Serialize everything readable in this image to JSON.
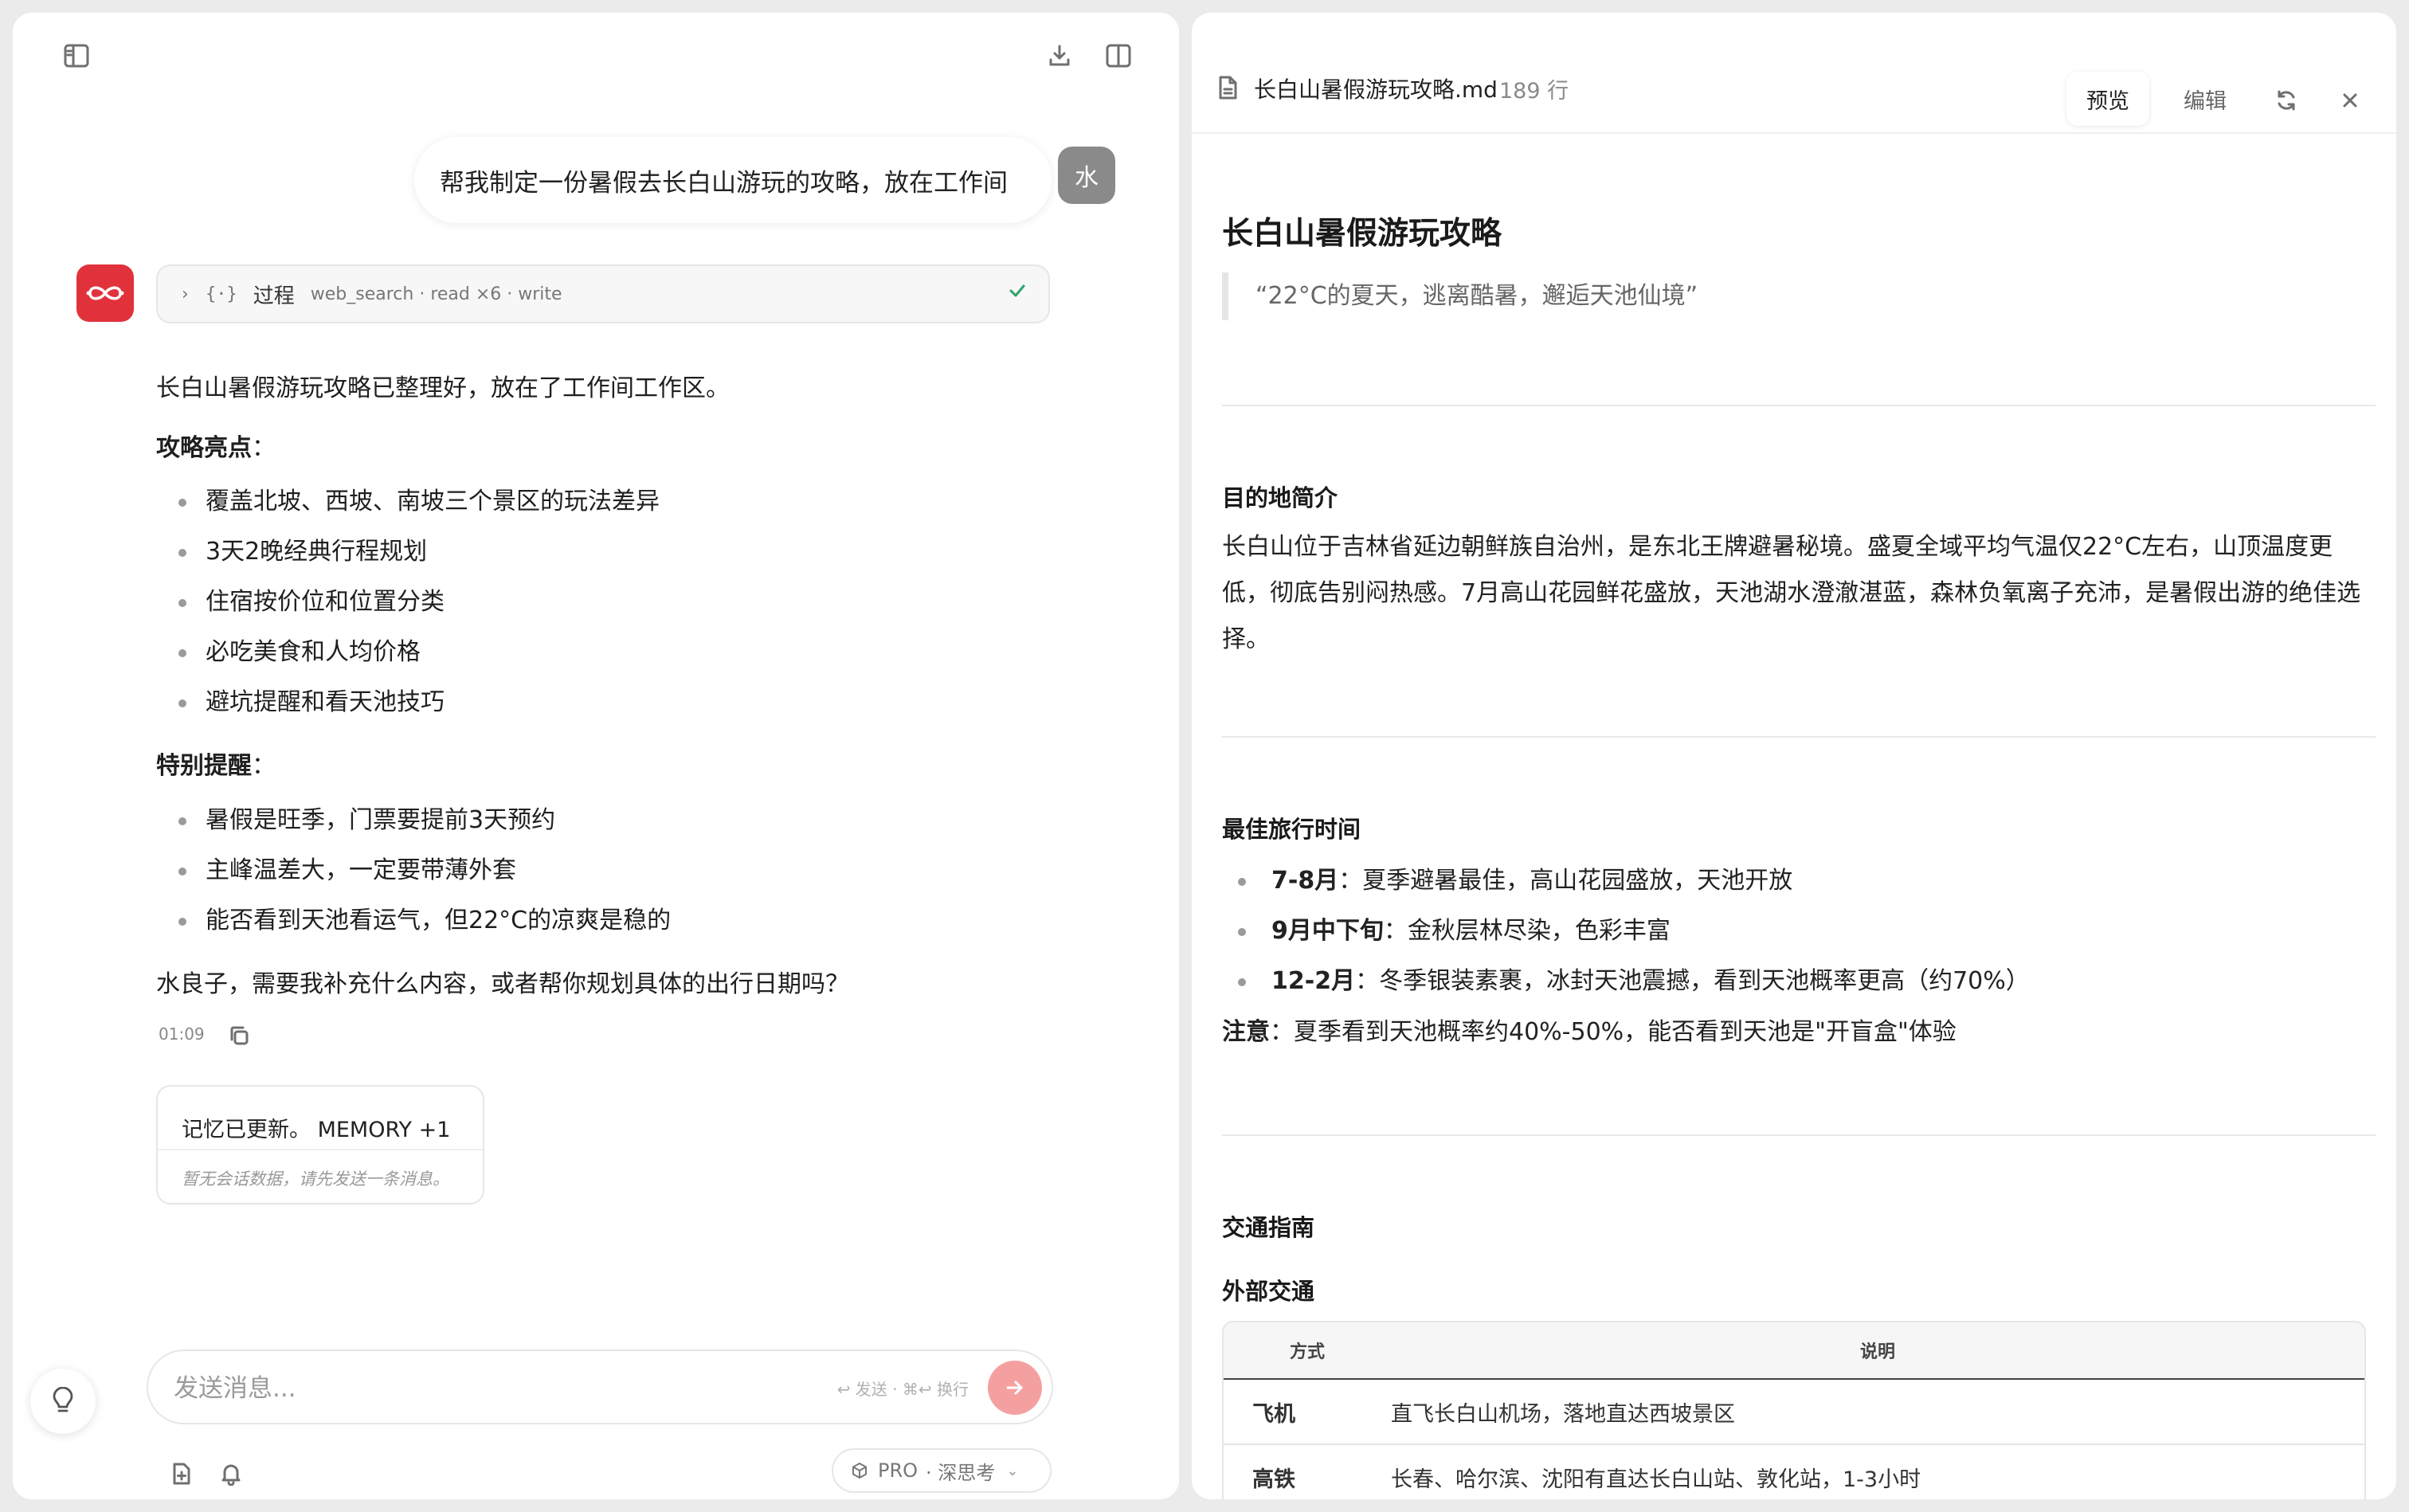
{
  "chat": {
    "user_message": "帮我制定一份暑假去长白山游玩的攻略，放在工作间",
    "user_avatar_text": "水",
    "process": {
      "title": "过程",
      "steps": "web_search · read ×6 · write"
    },
    "reply": {
      "intro": "长白山暑假游玩攻略已整理好，放在了工作间工作区。",
      "highlights_title": "攻略亮点",
      "highlights": [
        "覆盖北坡、西坡、南坡三个景区的玩法差异",
        "3天2晚经典行程规划",
        "住宿按价位和位置分类",
        "必吃美食和人均价格",
        "避坑提醒和看天池技巧"
      ],
      "reminders_title": "特别提醒",
      "reminders": [
        "暑假是旺季，门票要提前3天预约",
        "主峰温差大，一定要带薄外套",
        "能否看到天池看运气，但22°C的凉爽是稳的"
      ],
      "closing": "水良子，需要我补充什么内容，或者帮你规划具体的出行日期吗？",
      "time": "01:09"
    },
    "memory": {
      "title": "记忆已更新。 MEMORY +1",
      "subtitle": "暂无会话数据，请先发送一条消息。"
    }
  },
  "composer": {
    "placeholder": "发送消息...",
    "hint": "↩ 发送 · ⌘↩ 换行",
    "mode": "PRO",
    "mode_option": "· 深思考"
  },
  "doc": {
    "filename": "长白山暑假游玩攻略.md",
    "line_count": "189 行",
    "tab_preview": "预览",
    "tab_edit": "编辑",
    "title": "长白山暑假游玩攻略",
    "quote": "“22°C的夏天，逃离酷暑，邂逅天池仙境”",
    "sections": {
      "intro_title": "目的地简介",
      "intro_text": "长白山位于吉林省延边朝鲜族自治州，是东北王牌避暑秘境。盛夏全域平均气温仅22°C左右，山顶温度更低，彻底告别闷热感。7月高山花园鲜花盛放，天池湖水澄澈湛蓝，森林负氧离子充沛，是暑假出游的绝佳选择。",
      "time_title": "最佳旅行时间",
      "time_items": [
        {
          "label": "7-8月",
          "text": "：夏季避暑最佳，高山花园盛放，天池开放"
        },
        {
          "label": "9月中下旬",
          "text": "：金秋层林尽染，色彩丰富"
        },
        {
          "label": "12-2月",
          "text": "：冬季银装素裹，冰封天池震撼，看到天池概率更高（约70%）"
        }
      ],
      "note_label": "注意",
      "note_text": "：夏季看到天池概率约40%-50%，能否看到天池是\"开盲盒\"体验",
      "transport_title": "交通指南",
      "external_title": "外部交通"
    },
    "table": {
      "headers": [
        "方式",
        "说明"
      ],
      "rows": [
        [
          "飞机",
          "直飞长白山机场，落地直达西坡景区"
        ],
        [
          "高铁",
          "长春、哈尔滨、沈阳有直达长白山站、敦化站，1-3小时"
        ]
      ]
    }
  },
  "colors": {
    "accent": "#e1323c",
    "send_button": "#f5a0a0",
    "check": "#2ea36a"
  }
}
